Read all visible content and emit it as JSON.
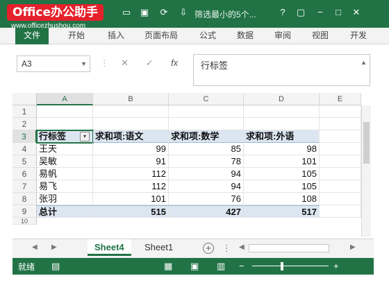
{
  "watermark": {
    "logo": "Office办公助手",
    "url": "www.officezhushou.com"
  },
  "title": {
    "doc": "筛选最小的5个...",
    "help": "?"
  },
  "ribbon": {
    "tabs": [
      "文件",
      "开始",
      "插入",
      "页面布局",
      "公式",
      "数据",
      "审阅",
      "视图",
      "开发"
    ]
  },
  "formula_bar": {
    "name_box": "A3",
    "content": "行标签"
  },
  "columns": [
    "A",
    "B",
    "C",
    "D",
    "E"
  ],
  "rows": [
    "1",
    "2",
    "3",
    "4",
    "5",
    "6",
    "7",
    "8",
    "9",
    "10"
  ],
  "pivot": {
    "header": [
      "行标签",
      "求和项:语文",
      "求和项:数学",
      "求和项:外语"
    ],
    "data": [
      [
        "王天",
        "99",
        "85",
        "98"
      ],
      [
        "吴敏",
        "91",
        "78",
        "101"
      ],
      [
        "易帆",
        "112",
        "94",
        "105"
      ],
      [
        "易飞",
        "112",
        "94",
        "105"
      ],
      [
        "张羽",
        "101",
        "76",
        "108"
      ]
    ],
    "total": [
      "总计",
      "515",
      "427",
      "517"
    ]
  },
  "sheets": {
    "tabs": [
      "Sheet4",
      "Sheet1"
    ],
    "active": "Sheet4"
  },
  "status": {
    "text": "就绪"
  },
  "colors": {
    "accent": "#217346",
    "pivot_fill": "#dce6f1"
  }
}
